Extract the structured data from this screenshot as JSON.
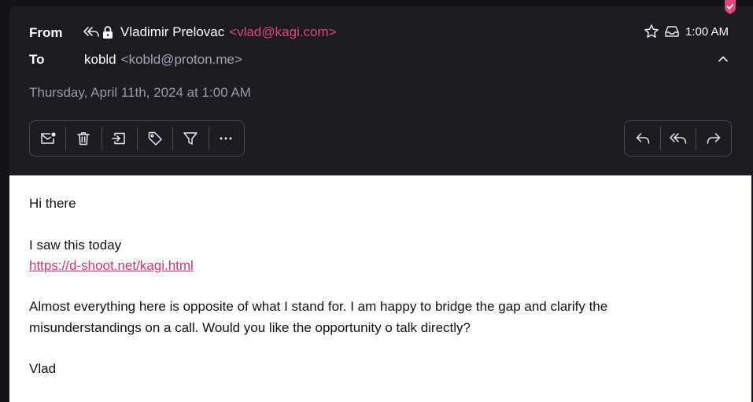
{
  "header": {
    "from_label": "From",
    "to_label": "To",
    "sender_name": "Vladimir Prelovac",
    "sender_email": "<vlad@kagi.com>",
    "recipient_name": "kobld",
    "recipient_email": "<kobld@proton.me>",
    "date": "Thursday, April 11th, 2024 at 1:00 AM",
    "time": "1:00 AM",
    "icons": {
      "replied_all": "reply-all-icon",
      "encrypted": "lock-icon",
      "star": "star-icon",
      "folder": "inbox-icon",
      "collapse": "chevron-up-icon",
      "badge": "shield-icon"
    },
    "colors": {
      "accent": "#e0457c",
      "header_bg": "#1c1b22",
      "badge": "#e0457c"
    }
  },
  "toolbar_left": [
    {
      "name": "mark-unread-button",
      "icon": "envelope-dot-icon"
    },
    {
      "name": "delete-button",
      "icon": "trash-icon"
    },
    {
      "name": "move-button",
      "icon": "move-to-icon"
    },
    {
      "name": "label-button",
      "icon": "tag-icon"
    },
    {
      "name": "filter-button",
      "icon": "filter-icon"
    },
    {
      "name": "more-button",
      "icon": "ellipsis-icon"
    }
  ],
  "toolbar_right": [
    {
      "name": "reply-button",
      "icon": "reply-icon"
    },
    {
      "name": "reply-all-button",
      "icon": "reply-all-icon"
    },
    {
      "name": "forward-button",
      "icon": "forward-icon"
    }
  ],
  "message": {
    "greeting": "Hi there",
    "line1": "I saw this today",
    "link": "https://d-shoot.net/kagi.html",
    "para_line1": "Almost everything here is opposite of what I stand for. I am happy to bridge the gap and clarify the",
    "para_line2": "misunderstandings on a call. Would you like the opportunity o talk directly?",
    "signature": "Vlad"
  }
}
